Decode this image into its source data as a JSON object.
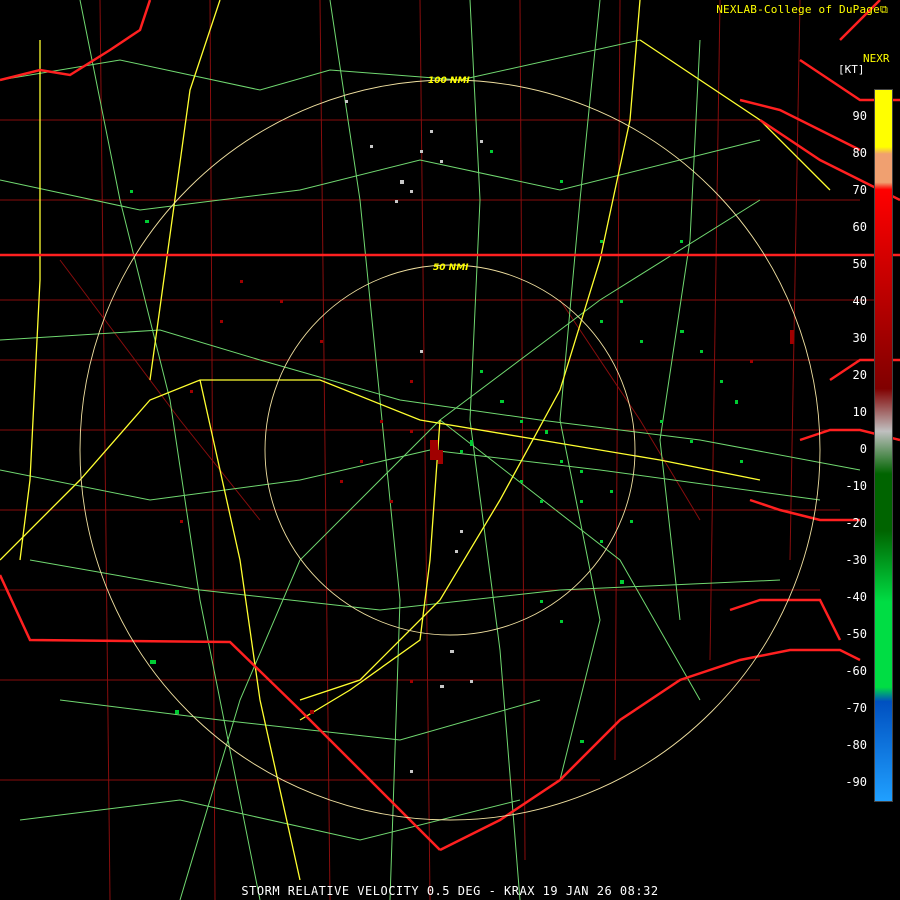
{
  "credit": "NEXLAB-College of DuPage",
  "credit_icon": "external-link-icon",
  "product": "NEXR",
  "units": "[KT]",
  "footer": "STORM RELATIVE VELOCITY 0.5 DEG - KRAX 19 JAN 26 08:32",
  "rings": [
    "100 NMI",
    "50 NMI"
  ],
  "legend": {
    "ticks": [
      "90",
      "80",
      "70",
      "60",
      "50",
      "40",
      "30",
      "20",
      "10",
      "0",
      "-10",
      "-20",
      "-30",
      "-40",
      "-50",
      "-60",
      "-70",
      "-80",
      "-90"
    ],
    "colors": [
      "#ffff00",
      "#f0a070",
      "#ff0000",
      "#800000",
      "#c0c0c0",
      "#006400",
      "#00dd44",
      "#0050c0",
      "#20a0ff"
    ]
  },
  "colors": {
    "state_border": "#ff2020",
    "highway": "#ffff40",
    "road": "#80e080",
    "county": "#b01010",
    "ring": "#f0e0a0"
  }
}
